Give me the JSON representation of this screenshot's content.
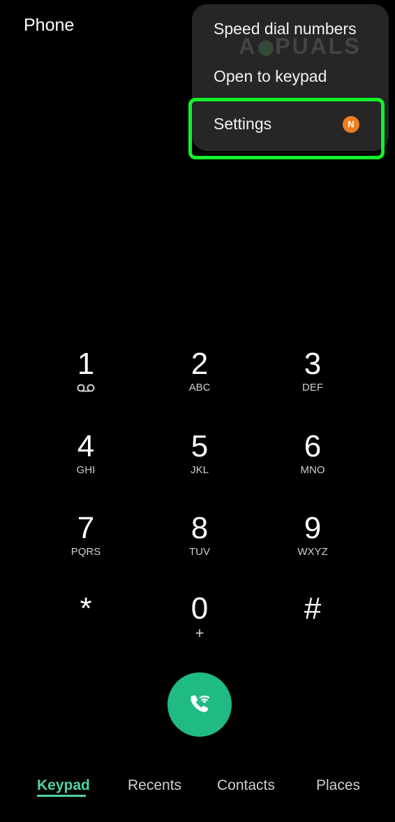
{
  "app": {
    "title": "Phone"
  },
  "menu": {
    "items": [
      {
        "label": "Speed dial numbers"
      },
      {
        "label": "Open to keypad"
      },
      {
        "label": "Settings",
        "badge": "N"
      }
    ],
    "badge_color": "#f07d1e",
    "highlight_color": "#13f22a"
  },
  "watermark": {
    "left": "A",
    "right": "PUALS"
  },
  "keypad": {
    "keys": [
      {
        "digit": "1",
        "letters": "",
        "icon": "voicemail-icon"
      },
      {
        "digit": "2",
        "letters": "ABC"
      },
      {
        "digit": "3",
        "letters": "DEF"
      },
      {
        "digit": "4",
        "letters": "GHI"
      },
      {
        "digit": "5",
        "letters": "JKL"
      },
      {
        "digit": "6",
        "letters": "MNO"
      },
      {
        "digit": "7",
        "letters": "PQRS"
      },
      {
        "digit": "8",
        "letters": "TUV"
      },
      {
        "digit": "9",
        "letters": "WXYZ"
      },
      {
        "digit": "*",
        "letters": ""
      },
      {
        "digit": "0",
        "letters": "+"
      },
      {
        "digit": "#",
        "letters": ""
      }
    ]
  },
  "call_button": {
    "icon": "wifi-call-icon",
    "color": "#1fbb82"
  },
  "tabs": [
    {
      "label": "Keypad",
      "active": true
    },
    {
      "label": "Recents",
      "active": false
    },
    {
      "label": "Contacts",
      "active": false
    },
    {
      "label": "Places",
      "active": false
    }
  ],
  "accent_color": "#4fd3a3"
}
